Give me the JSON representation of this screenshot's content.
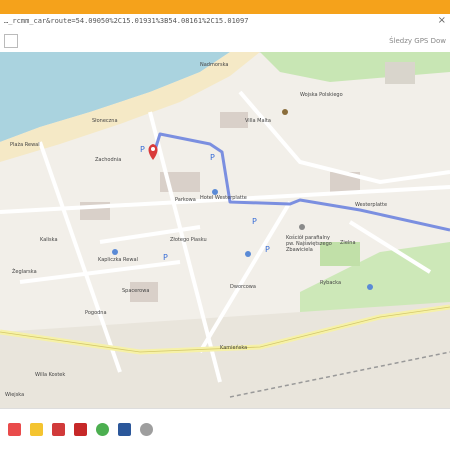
{
  "browser": {
    "url": "…_rcmm_car&route=54.09050%2C15.01931%3B54.08161%2C15.01097",
    "close_glyph": "×",
    "gps_label": "Śledzy GPS   Dow"
  },
  "map": {
    "streets": {
      "sloneczna": "Słoneczna",
      "parkowa": "Parkowa",
      "westerplatte": "Westerplatte",
      "wojska_polskiego": "Wojska Polskiego",
      "kamienska": "Kamieńska",
      "pogodna": "Pogodna",
      "dworcowa": "Dworcowa",
      "kaliska": "Kaliska",
      "zeglarska": "Żeglarska",
      "zachodnia": "Zachodnia",
      "spacerowa": "Spacerowa",
      "zlotego_piasku": "Złotego Piasku",
      "zielna": "Zielna",
      "rybacka": "Rybacka",
      "wiejska": "Wiejska",
      "nadmorska": "Nadmorska"
    },
    "pois": {
      "church": "Kościół parafialny pw. Najświętszego Zbawiciela",
      "kapliczka": "Kapliczka Rewal",
      "hotel": "Hotel Westerplatte",
      "villa": "Villa Malta",
      "beach": "Plaża Rewal",
      "willa_kostek": "Willa Kostek"
    },
    "route_color": "#7b8fe0"
  },
  "taskbar": {
    "icons": [
      "windows-icon",
      "folder-icon",
      "pdf-icon",
      "acrobat-icon",
      "chrome-icon",
      "word-icon",
      "chrome-alt-icon"
    ]
  }
}
